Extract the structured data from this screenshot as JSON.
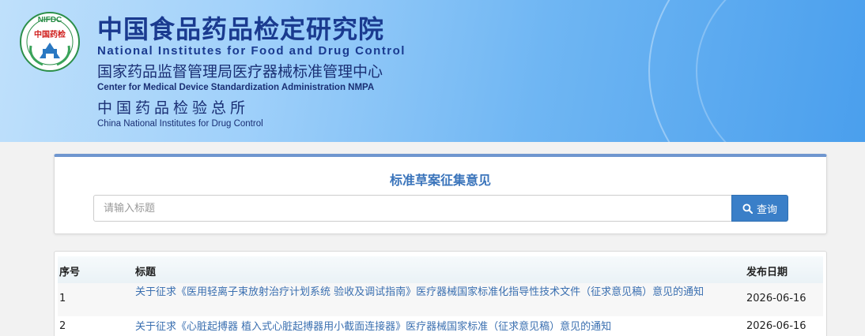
{
  "header": {
    "logo_text_top": "NIFDC",
    "logo_text_mid": "中国药检",
    "main_title_cn": "中国食品药品检定研究院",
    "main_title_en": "National Institutes for Food and Drug Control",
    "sub_title_cn": "国家药品监督管理局医疗器械标准管理中心",
    "sub_title_en": "Center for Medical Device Standardization Administration NMPA",
    "third_title_cn": "中国药品检验总所",
    "third_title_en": "China National Institutes for Drug Control"
  },
  "search_panel": {
    "title": "标准草案征集意见",
    "placeholder": "请输入标题",
    "button_label": "查询"
  },
  "table": {
    "columns": [
      "序号",
      "标题",
      "发布日期"
    ],
    "rows": [
      {
        "index": "1",
        "title": "关于征求《医用轻离子束放射治疗计划系统 验收及调试指南》医疗器械国家标准化指导性技术文件（征求意见稿）意见的通知",
        "date": "2026-06-16"
      },
      {
        "index": "2",
        "title": "关于征求《心脏起搏器 植入式心脏起搏器用小截面连接器》医疗器械国家标准（征求意见稿）意见的通知",
        "date": "2026-06-16"
      }
    ]
  },
  "colors": {
    "brand_navy": "#1a3a8f",
    "accent_blue": "#3a7fc8",
    "link_blue": "#3a6fb0",
    "panel_top_border": "#6f96cf"
  }
}
